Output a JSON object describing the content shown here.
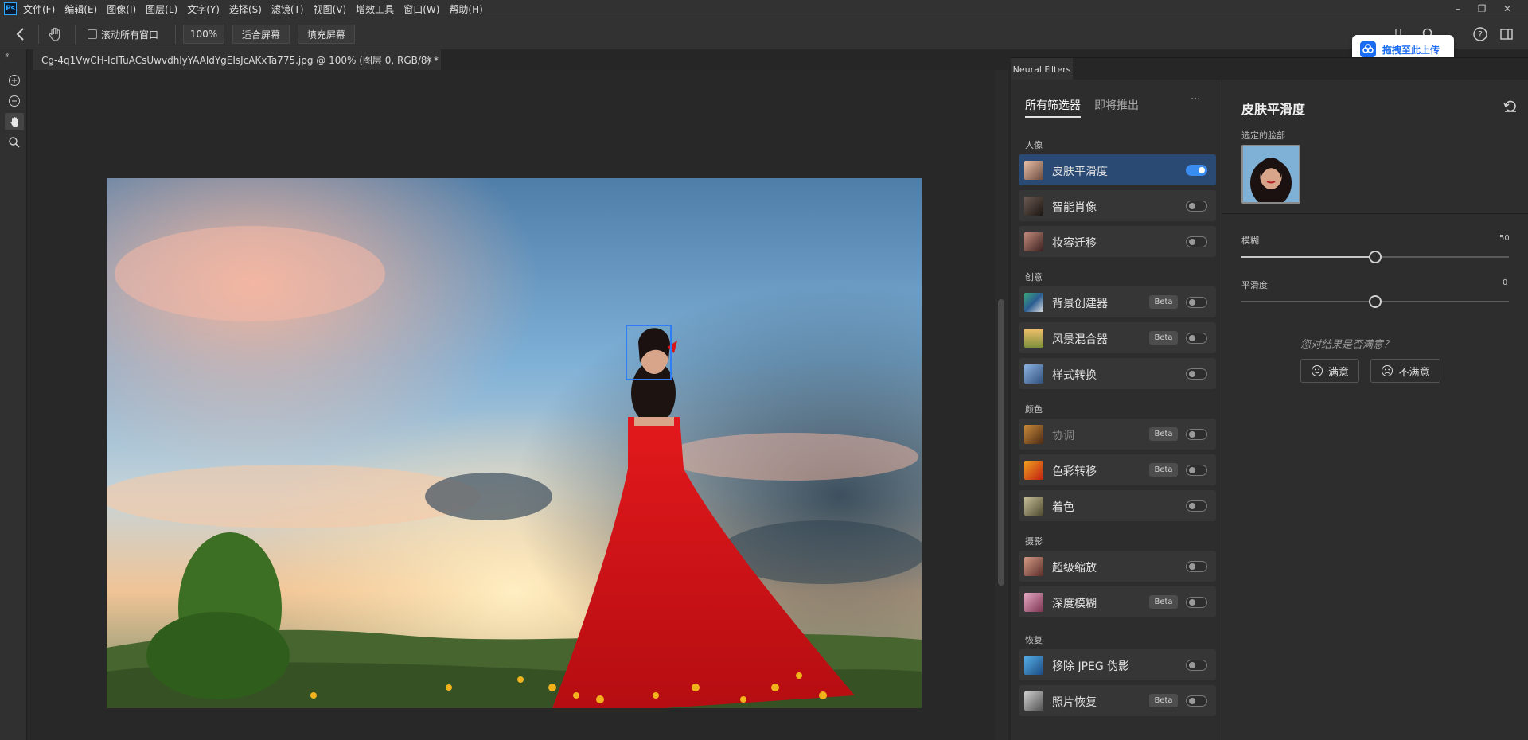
{
  "app": {
    "logo": "Ps",
    "accent": "#31a8ff"
  },
  "menu": [
    "文件(F)",
    "编辑(E)",
    "图像(I)",
    "图层(L)",
    "文字(Y)",
    "选择(S)",
    "滤镜(T)",
    "视图(V)",
    "增效工具",
    "窗口(W)",
    "帮助(H)"
  ],
  "window_controls": [
    "–",
    "❐",
    "✕"
  ],
  "options": {
    "scroll_all_label": "滚动所有窗口",
    "zoom": "100%",
    "fit_label": "适合屏幕",
    "fill_label": "填充屏幕"
  },
  "document": {
    "tab_title": "Cg-4q1VwCH-IcITuACsUwvdhlyYAAldYgEIsJcAKxTa775.jpg @ 100% (图层 0, RGB/8) *",
    "close": "×"
  },
  "upload_badge": {
    "label": "拖拽至此上传"
  },
  "neural_filters": {
    "panel_title": "Neural Filters",
    "tabs": {
      "all": "所有筛选器",
      "upcoming": "即将推出",
      "more": "···"
    },
    "sections": [
      {
        "label": "人像",
        "filters": [
          {
            "name": "皮肤平滑度",
            "beta": "",
            "on": true,
            "selected": true,
            "icon": "portrait-skin"
          },
          {
            "name": "智能肖像",
            "beta": "",
            "on": false,
            "icon": "portrait-smart"
          },
          {
            "name": "妆容迁移",
            "beta": "",
            "on": false,
            "icon": "portrait-makeup"
          }
        ]
      },
      {
        "label": "创意",
        "filters": [
          {
            "name": "背景创建器",
            "beta": "Beta",
            "on": false,
            "icon": "background-creator"
          },
          {
            "name": "风景混合器",
            "beta": "Beta",
            "on": false,
            "icon": "landscape-mixer"
          },
          {
            "name": "样式转换",
            "beta": "",
            "on": false,
            "icon": "style-transfer"
          }
        ]
      },
      {
        "label": "颜色",
        "filters": [
          {
            "name": "协调",
            "beta": "Beta",
            "on": false,
            "dim": true,
            "icon": "harmonize"
          },
          {
            "name": "色彩转移",
            "beta": "Beta",
            "on": false,
            "icon": "color-transfer"
          },
          {
            "name": "着色",
            "beta": "",
            "on": false,
            "icon": "colorize"
          }
        ]
      },
      {
        "label": "摄影",
        "filters": [
          {
            "name": "超级缩放",
            "beta": "",
            "on": false,
            "icon": "super-zoom"
          },
          {
            "name": "深度模糊",
            "beta": "Beta",
            "on": false,
            "icon": "depth-blur"
          }
        ]
      },
      {
        "label": "恢复",
        "filters": [
          {
            "name": "移除 JPEG 伪影",
            "beta": "",
            "on": false,
            "icon": "jpeg-artifacts"
          },
          {
            "name": "照片恢复",
            "beta": "Beta",
            "on": false,
            "icon": "photo-restoration"
          }
        ]
      }
    ],
    "settings": {
      "title": "皮肤平滑度",
      "selected_face_label": "选定的脸部",
      "blur_label": "模糊",
      "blur_value": "50",
      "blur_fraction": 0.5,
      "smooth_label": "平滑度",
      "smooth_value": "0",
      "smooth_fraction": 0.5,
      "feedback_prompt": "您对结果是否满意？",
      "satisfied": "满意",
      "unsatisfied": "不满意"
    }
  },
  "colors": {
    "toggle_on": "#3b8cf0",
    "selected_row": "#2a4a74",
    "face_box": "#2f7df6",
    "dress": "#d8161a"
  }
}
